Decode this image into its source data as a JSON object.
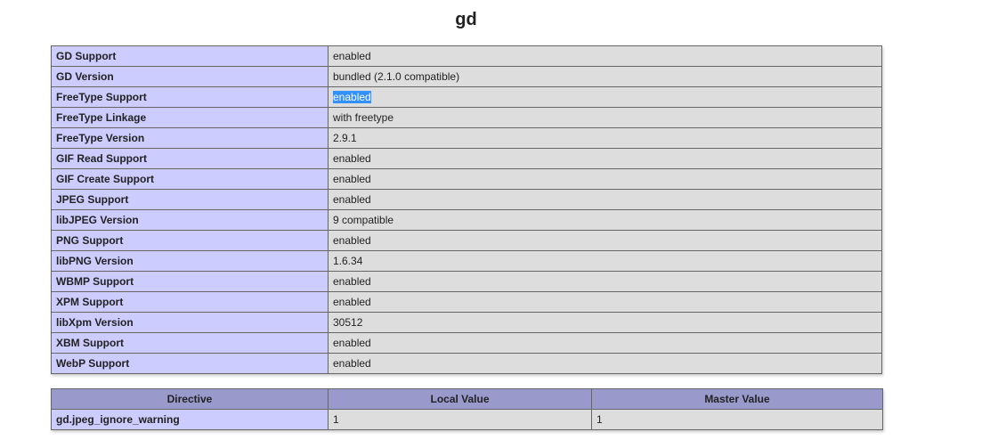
{
  "title": "gd",
  "info_rows": [
    {
      "label": "GD Support",
      "value": "enabled"
    },
    {
      "label": "GD Version",
      "value": "bundled (2.1.0 compatible)"
    },
    {
      "label": "FreeType Support",
      "value": "enabled",
      "selected": true
    },
    {
      "label": "FreeType Linkage",
      "value": "with freetype"
    },
    {
      "label": "FreeType Version",
      "value": "2.9.1"
    },
    {
      "label": "GIF Read Support",
      "value": "enabled"
    },
    {
      "label": "GIF Create Support",
      "value": "enabled"
    },
    {
      "label": "JPEG Support",
      "value": "enabled"
    },
    {
      "label": "libJPEG Version",
      "value": "9 compatible"
    },
    {
      "label": "PNG Support",
      "value": "enabled"
    },
    {
      "label": "libPNG Version",
      "value": "1.6.34"
    },
    {
      "label": "WBMP Support",
      "value": "enabled"
    },
    {
      "label": "XPM Support",
      "value": "enabled"
    },
    {
      "label": "libXpm Version",
      "value": "30512"
    },
    {
      "label": "XBM Support",
      "value": "enabled"
    },
    {
      "label": "WebP Support",
      "value": "enabled"
    }
  ],
  "directives": {
    "headers": [
      "Directive",
      "Local Value",
      "Master Value"
    ],
    "rows": [
      {
        "directive": "gd.jpeg_ignore_warning",
        "local": "1",
        "master": "1"
      }
    ]
  },
  "colors": {
    "label_cell": "#ccccff",
    "value_cell": "#dddddd",
    "header_cell": "#9999cc",
    "selection": "#3390ff"
  }
}
